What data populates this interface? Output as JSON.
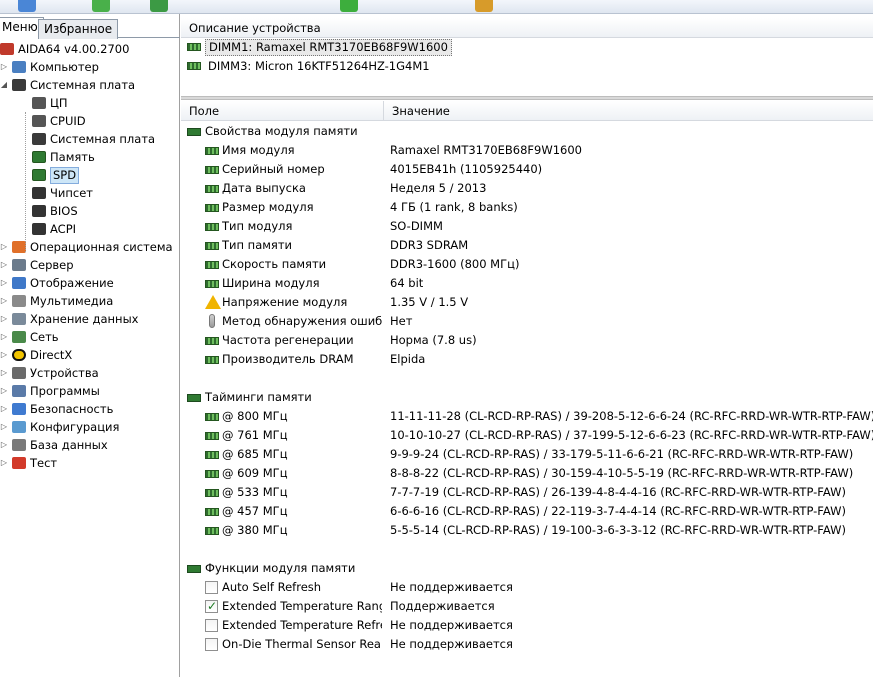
{
  "left_panel": {
    "tabs": [
      "Меню",
      "Избранное"
    ],
    "active_tab": 0,
    "tree": [
      {
        "label": "AIDA64 v4.00.2700",
        "level": 0,
        "icon": "aida-logo-icon",
        "expander": ""
      },
      {
        "label": "Компьютер",
        "level": 1,
        "icon": "computer-icon",
        "expander": "▷"
      },
      {
        "label": "Системная плата",
        "level": 1,
        "icon": "motherboard-icon",
        "expander": "◢"
      },
      {
        "label": "ЦП",
        "level": 2,
        "icon": "cpu-icon",
        "expander": ""
      },
      {
        "label": "CPUID",
        "level": 2,
        "icon": "cpuid-icon",
        "expander": ""
      },
      {
        "label": "Системная плата",
        "level": 2,
        "icon": "motherboard-icon",
        "expander": ""
      },
      {
        "label": "Память",
        "level": 2,
        "icon": "memory-icon",
        "expander": ""
      },
      {
        "label": "SPD",
        "level": 2,
        "icon": "memory-icon",
        "expander": "",
        "selected": true
      },
      {
        "label": "Чипсет",
        "level": 2,
        "icon": "chipset-icon",
        "expander": ""
      },
      {
        "label": "BIOS",
        "level": 2,
        "icon": "bios-icon",
        "expander": ""
      },
      {
        "label": "ACPI",
        "level": 2,
        "icon": "acpi-icon",
        "expander": ""
      },
      {
        "label": "Операционная система",
        "level": 1,
        "icon": "windows-icon",
        "expander": "▷"
      },
      {
        "label": "Сервер",
        "level": 1,
        "icon": "server-icon",
        "expander": "▷"
      },
      {
        "label": "Отображение",
        "level": 1,
        "icon": "display-icon",
        "expander": "▷"
      },
      {
        "label": "Мультимедиа",
        "level": 1,
        "icon": "speaker-icon",
        "expander": "▷"
      },
      {
        "label": "Хранение данных",
        "level": 1,
        "icon": "storage-icon",
        "expander": "▷"
      },
      {
        "label": "Сеть",
        "level": 1,
        "icon": "network-icon",
        "expander": "▷"
      },
      {
        "label": "DirectX",
        "level": 1,
        "icon": "directx-icon",
        "expander": "▷"
      },
      {
        "label": "Устройства",
        "level": 1,
        "icon": "devices-icon",
        "expander": "▷"
      },
      {
        "label": "Программы",
        "level": 1,
        "icon": "programs-icon",
        "expander": "▷"
      },
      {
        "label": "Безопасность",
        "level": 1,
        "icon": "shield-icon",
        "expander": "▷"
      },
      {
        "label": "Конфигурация",
        "level": 1,
        "icon": "config-icon",
        "expander": "▷"
      },
      {
        "label": "База данных",
        "level": 1,
        "icon": "database-icon",
        "expander": "▷"
      },
      {
        "label": "Тест",
        "level": 1,
        "icon": "test-icon",
        "expander": "▷"
      }
    ]
  },
  "device_panel": {
    "header": "Описание устройства",
    "devices": [
      {
        "label": "DIMM1: Ramaxel RMT3170EB68F9W1600",
        "selected": true
      },
      {
        "label": "DIMM3: Micron 16KTF51264HZ-1G4M1",
        "selected": false
      }
    ]
  },
  "details": {
    "col_field": "Поле",
    "col_value": "Значение",
    "sections": [
      {
        "title": "Свойства модуля памяти",
        "rows": [
          {
            "field": "Имя модуля",
            "value": "Ramaxel RMT3170EB68F9W1600",
            "icon": "ram-icon"
          },
          {
            "field": "Серийный номер",
            "value": "4015EB41h (1105925440)",
            "icon": "ram-icon"
          },
          {
            "field": "Дата выпуска",
            "value": "Неделя 5 / 2013",
            "icon": "ram-icon"
          },
          {
            "field": "Размер модуля",
            "value": "4 ГБ (1 rank, 8 banks)",
            "icon": "ram-icon"
          },
          {
            "field": "Тип модуля",
            "value": "SO-DIMM",
            "icon": "ram-icon"
          },
          {
            "field": "Тип памяти",
            "value": "DDR3 SDRAM",
            "icon": "ram-icon"
          },
          {
            "field": "Скорость памяти",
            "value": "DDR3-1600 (800 МГц)",
            "icon": "ram-icon"
          },
          {
            "field": "Ширина модуля",
            "value": "64 bit",
            "icon": "ram-icon"
          },
          {
            "field": "Напряжение модуля",
            "value": "1.35 V / 1.5 V",
            "icon": "warning-icon"
          },
          {
            "field": "Метод обнаружения ошиб…",
            "value": "Нет",
            "icon": "thermometer-icon"
          },
          {
            "field": "Частота регенерации",
            "value": "Норма (7.8 us)",
            "icon": "ram-icon"
          },
          {
            "field": "Производитель DRAM",
            "value": "Elpida",
            "icon": "ram-icon"
          }
        ]
      },
      {
        "title": "Тайминги памяти",
        "rows": [
          {
            "field": "@ 800 МГц",
            "value": "11-11-11-28  (CL-RCD-RP-RAS) / 39-208-5-12-6-6-24  (RC-RFC-RRD-WR-WTR-RTP-FAW)",
            "icon": "ram-icon"
          },
          {
            "field": "@ 761 МГц",
            "value": "10-10-10-27  (CL-RCD-RP-RAS) / 37-199-5-12-6-6-23  (RC-RFC-RRD-WR-WTR-RTP-FAW)",
            "icon": "ram-icon"
          },
          {
            "field": "@ 685 МГц",
            "value": "9-9-9-24  (CL-RCD-RP-RAS) / 33-179-5-11-6-6-21  (RC-RFC-RRD-WR-WTR-RTP-FAW)",
            "icon": "ram-icon"
          },
          {
            "field": "@ 609 МГц",
            "value": "8-8-8-22  (CL-RCD-RP-RAS) / 30-159-4-10-5-5-19  (RC-RFC-RRD-WR-WTR-RTP-FAW)",
            "icon": "ram-icon"
          },
          {
            "field": "@ 533 МГц",
            "value": "7-7-7-19  (CL-RCD-RP-RAS) / 26-139-4-8-4-4-16  (RC-RFC-RRD-WR-WTR-RTP-FAW)",
            "icon": "ram-icon"
          },
          {
            "field": "@ 457 МГц",
            "value": "6-6-6-16  (CL-RCD-RP-RAS) / 22-119-3-7-4-4-14  (RC-RFC-RRD-WR-WTR-RTP-FAW)",
            "icon": "ram-icon"
          },
          {
            "field": "@ 380 МГц",
            "value": "5-5-5-14  (CL-RCD-RP-RAS) / 19-100-3-6-3-3-12  (RC-RFC-RRD-WR-WTR-RTP-FAW)",
            "icon": "ram-icon"
          }
        ]
      },
      {
        "title": "Функции модуля памяти",
        "rows": [
          {
            "field": "Auto Self Refresh",
            "value": "Не поддерживается",
            "checkbox": false
          },
          {
            "field": "Extended Temperature Range",
            "value": "Поддерживается",
            "checkbox": true
          },
          {
            "field": "Extended Temperature Refre…",
            "value": "Не поддерживается",
            "checkbox": false
          },
          {
            "field": "On-Die Thermal Sensor Rea…",
            "value": "Не поддерживается",
            "checkbox": false
          }
        ]
      }
    ]
  },
  "colors": {
    "selection_bg": "#cde6f7",
    "ram_green": "#2f7a32",
    "warning": "#f0b400"
  }
}
